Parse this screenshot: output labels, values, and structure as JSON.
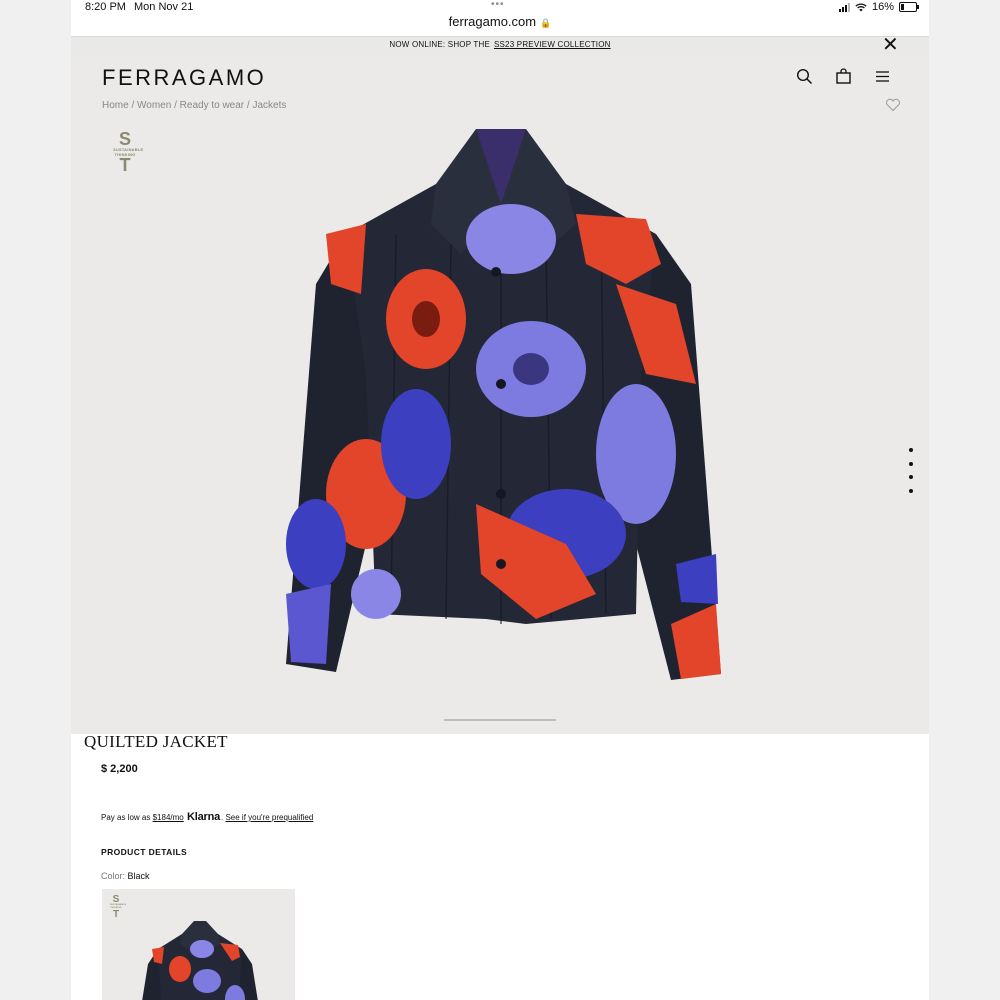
{
  "status_bar": {
    "time": "8:20 PM",
    "date": "Mon Nov 21",
    "battery": "16%",
    "dots": "•••"
  },
  "url_bar": {
    "domain": "ferragamo.com"
  },
  "promo": {
    "text": "NOW ONLINE: SHOP THE",
    "link": "SS23 PREVIEW COLLECTION"
  },
  "header": {
    "logo": "FERRAGAMO"
  },
  "icons": {
    "search": "search-icon",
    "bag": "bag-icon",
    "menu": "menu-icon",
    "favorite": "heart-icon",
    "close": "close-icon"
  },
  "breadcrumb": [
    "Home",
    "Women",
    "Ready to wear",
    "Jackets"
  ],
  "badge": {
    "top": "S",
    "middle": "SUSTAINABLE THINKING",
    "bottom": "T"
  },
  "product": {
    "title": "QUILTED JACKET",
    "price": "$ 2,200",
    "klarna": {
      "prefix": "Pay as low as",
      "amount": "$184/mo",
      "brand": "Klarna",
      "link": "See if you're prequalified"
    },
    "details_heading": "PRODUCT DETAILS",
    "color_label": "Color:",
    "color_value": "Black"
  },
  "colors": {
    "hero_bg": "#ebeae8",
    "badge": "#8b8a6e",
    "jacket_base": "#1f2330",
    "flower_red": "#e2452a",
    "flower_purple": "#7d7be0",
    "flower_blue": "#3c3fbf"
  }
}
